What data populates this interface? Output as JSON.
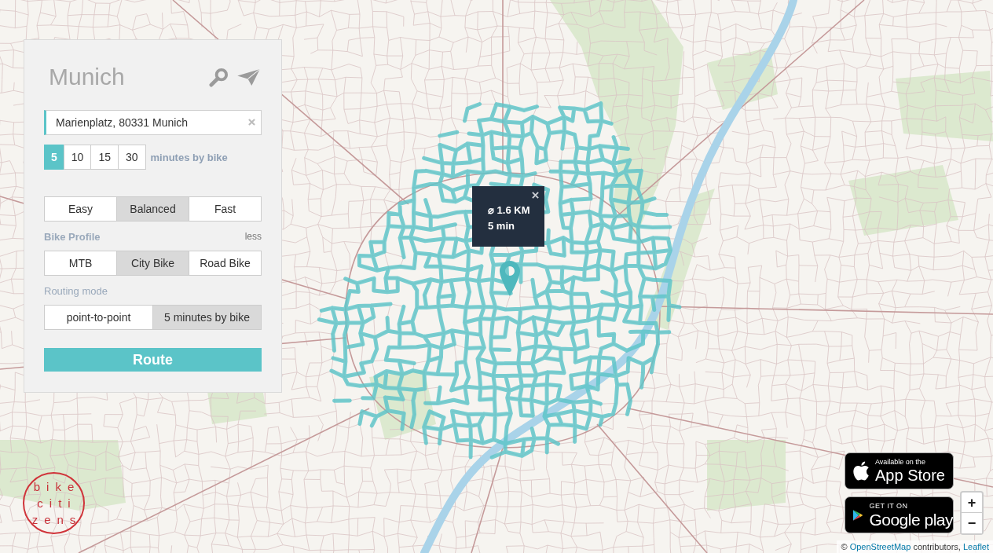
{
  "panel": {
    "title": "Munich",
    "address": {
      "value": "Marienplatz, 80331 Munich"
    },
    "durations": [
      {
        "label": "5",
        "selected": true
      },
      {
        "label": "10",
        "selected": false
      },
      {
        "label": "15",
        "selected": false
      },
      {
        "label": "30",
        "selected": false
      }
    ],
    "durations_caption": "minutes by bike",
    "route_types": [
      {
        "label": "Easy",
        "selected": false
      },
      {
        "label": "Balanced",
        "selected": true
      },
      {
        "label": "Fast",
        "selected": false
      }
    ],
    "bike_profile": {
      "label": "Bike Profile",
      "toggle": "less",
      "options": [
        {
          "label": "MTB",
          "selected": false
        },
        {
          "label": "City Bike",
          "selected": true
        },
        {
          "label": "Road Bike",
          "selected": false
        }
      ]
    },
    "routing_mode": {
      "label": "Routing mode",
      "options": [
        {
          "label": "point-to-point",
          "selected": false
        },
        {
          "label": "5 minutes by bike",
          "selected": true
        }
      ]
    },
    "route_button": "Route"
  },
  "map": {
    "popup": {
      "distance": "⌀ 1.6 KM",
      "duration": "5 min"
    },
    "zoom_controls": [
      "+",
      "−"
    ],
    "attribution": [
      {
        "kind": "text",
        "text": "©"
      },
      {
        "kind": "link",
        "text": "OpenStreetMap"
      },
      {
        "kind": "text",
        "text": "contributors,"
      },
      {
        "kind": "link",
        "text": "Leaflet"
      }
    ]
  },
  "store_badges": [
    {
      "kind": "apple",
      "caption": "Available on the",
      "name": "App Store"
    },
    {
      "kind": "google",
      "caption": "GET IT ON",
      "name": "Google play"
    }
  ],
  "logo": {
    "lines": [
      "bike",
      "citi",
      "zens"
    ]
  }
}
